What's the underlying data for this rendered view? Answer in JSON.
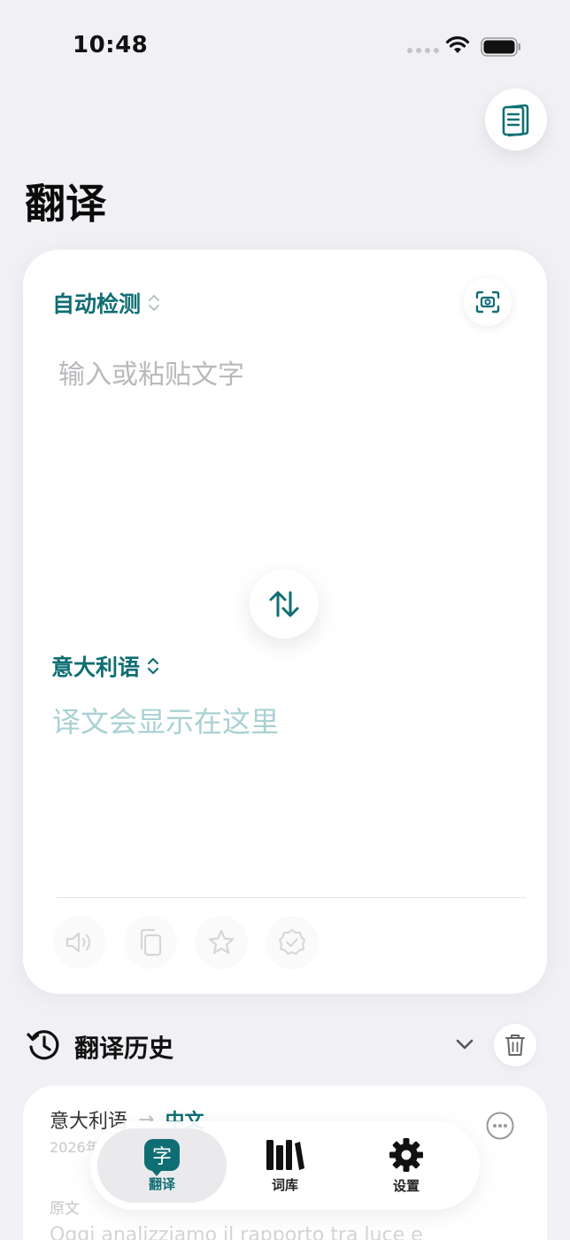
{
  "status_bar": {
    "time": "10:48"
  },
  "page": {
    "title": "翻译"
  },
  "translator": {
    "source_language": "自动检测",
    "input_placeholder": "输入或粘贴文字",
    "target_language": "意大利语",
    "output_placeholder": "译文会显示在这里"
  },
  "history": {
    "title": "翻译历史",
    "entry": {
      "from": "意大利语",
      "arrow": "→",
      "to": "中文",
      "date": "2026年",
      "original_label": "原文",
      "original_text": "Oggi analizziamo il rapporto tra luce e"
    }
  },
  "tabs": [
    {
      "label": "翻译",
      "glyph": "字",
      "active": true
    },
    {
      "label": "词库",
      "active": false
    },
    {
      "label": "设置",
      "active": false
    }
  ],
  "colors": {
    "accent": "#0f6e73",
    "background": "#f1f1f5",
    "placeholder_accent": "#a9d1d3"
  }
}
